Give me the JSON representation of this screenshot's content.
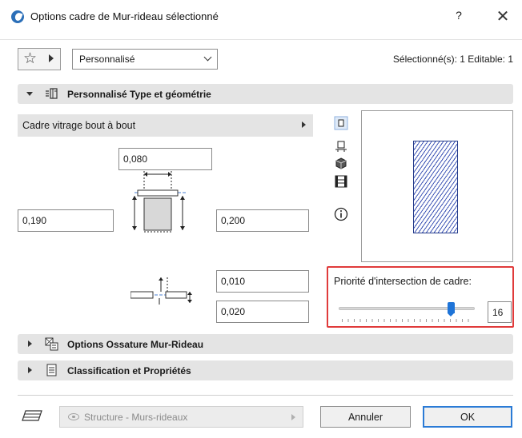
{
  "window": {
    "title": "Options cadre de Mur-rideau sélectionné",
    "help_label": "?",
    "close_label": "✕"
  },
  "toolbar": {
    "favorite_icon": "star-icon",
    "profile": "Personnalisé",
    "selection_info": "Sélectionné(s): 1 Editable: 1"
  },
  "geometry_section": {
    "title": "Personnalisé Type et géométrie",
    "frame_type": "Cadre vitrage bout à bout",
    "width_top": "0,080",
    "depth_left": "0,190",
    "depth_right": "0,200",
    "offset_a": "0,010",
    "offset_b": "0,020",
    "view_icons": [
      "plan-view-icon",
      "section-view-icon",
      "3d-view-icon",
      "elevation-view-icon",
      "info-icon"
    ]
  },
  "priority": {
    "label": "Priorité d'intersection de cadre:",
    "value": "16",
    "level": 0.8
  },
  "collapsed_sections": {
    "framing": "Options Ossature Mur-Rideau",
    "classification": "Classification et Propriétés"
  },
  "footer": {
    "layer": "Structure - Murs-rideaux",
    "cancel_label": "Annuler",
    "ok_label": "OK"
  },
  "colors": {
    "accent": "#2b7bd6",
    "highlight_border": "#e03b3b",
    "hatch": "#3d54b5"
  }
}
